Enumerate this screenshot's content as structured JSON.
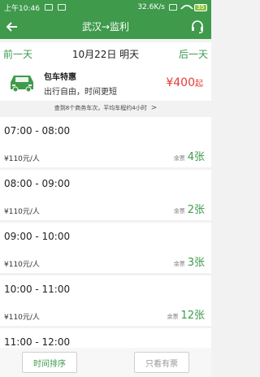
{
  "status": {
    "time": "上午10:46",
    "speed": "32.6K/s",
    "battery": "35"
  },
  "header": {
    "title": "武汉→监利"
  },
  "datebar": {
    "prev": "前一天",
    "current": "10月22日 明天",
    "next": "后一天"
  },
  "charter": {
    "title": "包车特惠",
    "subtitle": "出行自由，时间更短",
    "price": "¥400",
    "price_suffix": "起"
  },
  "notice": {
    "text": "查到8个商务车次，平均车程约4小时"
  },
  "trips": [
    {
      "time": "07:00 - 08:00",
      "fare": "¥110元/人",
      "remain_label": "余票",
      "remain": "4张"
    },
    {
      "time": "08:00 - 09:00",
      "fare": "¥110元/人",
      "remain_label": "余票",
      "remain": "2张"
    },
    {
      "time": "09:00 - 10:00",
      "fare": "¥110元/人",
      "remain_label": "余票",
      "remain": "3张"
    },
    {
      "time": "10:00 - 11:00",
      "fare": "¥110元/人",
      "remain_label": "余票",
      "remain": "12张"
    },
    {
      "time": "11:00 - 12:00",
      "fare": "",
      "remain_label": "",
      "remain": ""
    }
  ],
  "bottom": {
    "sort": "时间排序",
    "only_available": "只看有票"
  },
  "colors": {
    "brand_green": "#3f9a4c",
    "price_red": "#e23b37"
  }
}
